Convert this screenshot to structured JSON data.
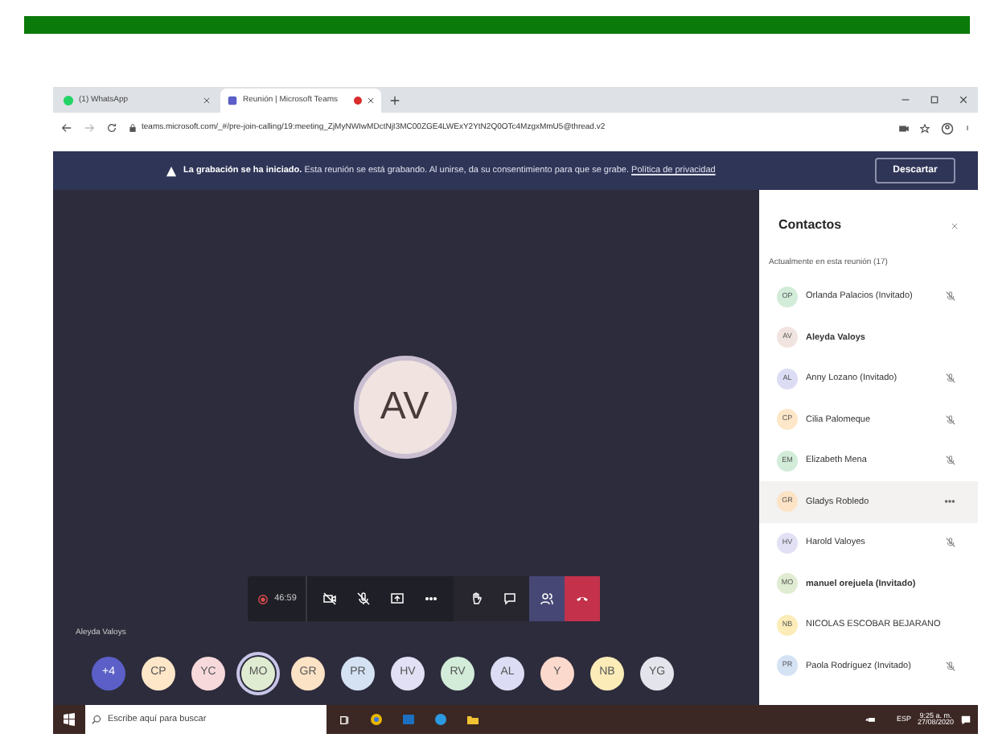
{
  "browser": {
    "tabs": [
      {
        "title": "(1) WhatsApp",
        "selected": false,
        "recording": false
      },
      {
        "title": "Reunión | Microsoft Teams",
        "selected": true,
        "recording": true
      }
    ],
    "url": "teams.microsoft.com/_#/pre-join-calling/19:meeting_ZjMyNWIwMDctNjI3MC00ZGE4LWExY2YtN2Q0OTc4MzgxMmU5@thread.v2"
  },
  "banner": {
    "bold": "La grabación se ha iniciado.",
    "text": "Esta reunión se está grabando. Al unirse, da su consentimiento para que se grabe.",
    "link": "Política de privacidad",
    "button": "Descartar"
  },
  "stage": {
    "main_avatar": "AV",
    "speaker_name": "Aleyda Valoys"
  },
  "toolbar": {
    "timer": "46:59",
    "participants_selected": true
  },
  "avatars": [
    {
      "initials": "+4",
      "color": "#5b5fc7",
      "selected": false
    },
    {
      "initials": "CP",
      "color": "#fde7c8",
      "selected": false
    },
    {
      "initials": "YC",
      "color": "#f7d9dc",
      "selected": false
    },
    {
      "initials": "MO",
      "color": "#e0ecd2",
      "selected": true
    },
    {
      "initials": "GR",
      "color": "#fde3c6",
      "selected": false
    },
    {
      "initials": "PR",
      "color": "#d4e2f4",
      "selected": false
    },
    {
      "initials": "HV",
      "color": "#e2e0f4",
      "selected": false
    },
    {
      "initials": "RV",
      "color": "#d2ecd9",
      "selected": false
    },
    {
      "initials": "AL",
      "color": "#dcdcf4",
      "selected": false
    },
    {
      "initials": "Y",
      "color": "#fbd9cc",
      "selected": false
    },
    {
      "initials": "NB",
      "color": "#fbecb8",
      "selected": false
    },
    {
      "initials": "YG",
      "color": "#e4e4ec",
      "selected": false
    }
  ],
  "panel": {
    "title": "Contactos",
    "section": "Actualmente en esta reunión (17)",
    "people": [
      {
        "initials": "OP",
        "name": "Orlanda Palacios (Invitado)",
        "color": "#d2ecd9",
        "bold": false,
        "muted": true,
        "selected": false
      },
      {
        "initials": "AV",
        "name": "Aleyda Valoys",
        "color": "#f1e4e0",
        "bold": true,
        "muted": false,
        "selected": false
      },
      {
        "initials": "AL",
        "name": "Anny Lozano (Invitado)",
        "color": "#dcdcf4",
        "bold": false,
        "muted": true,
        "selected": false
      },
      {
        "initials": "CP",
        "name": "Cilia Palomeque",
        "color": "#fde7c8",
        "bold": false,
        "muted": true,
        "selected": false
      },
      {
        "initials": "EM",
        "name": "Elizabeth Mena",
        "color": "#d2ecd9",
        "bold": false,
        "muted": true,
        "selected": false
      },
      {
        "initials": "GR",
        "name": "Gladys Robledo",
        "color": "#fde3c6",
        "bold": false,
        "muted": false,
        "selected": true
      },
      {
        "initials": "HV",
        "name": "Harold Valoyes",
        "color": "#e2e0f4",
        "bold": false,
        "muted": true,
        "selected": false
      },
      {
        "initials": "MO",
        "name": "manuel orejuela (Invitado)",
        "color": "#e0ecd2",
        "bold": true,
        "muted": false,
        "selected": false
      },
      {
        "initials": "NB",
        "name": "NICOLAS ESCOBAR BEJARANO",
        "color": "#fbecb8",
        "bold": false,
        "muted": false,
        "selected": false
      },
      {
        "initials": "PR",
        "name": "Paola Rodríguez (Invitado)",
        "color": "#d4e2f4",
        "bold": false,
        "muted": true,
        "selected": false
      }
    ]
  },
  "taskbar": {
    "search_placeholder": "Escribe aquí para buscar",
    "language": "ESP",
    "time": "9:25 a. m.",
    "date": "27/08/2020"
  }
}
